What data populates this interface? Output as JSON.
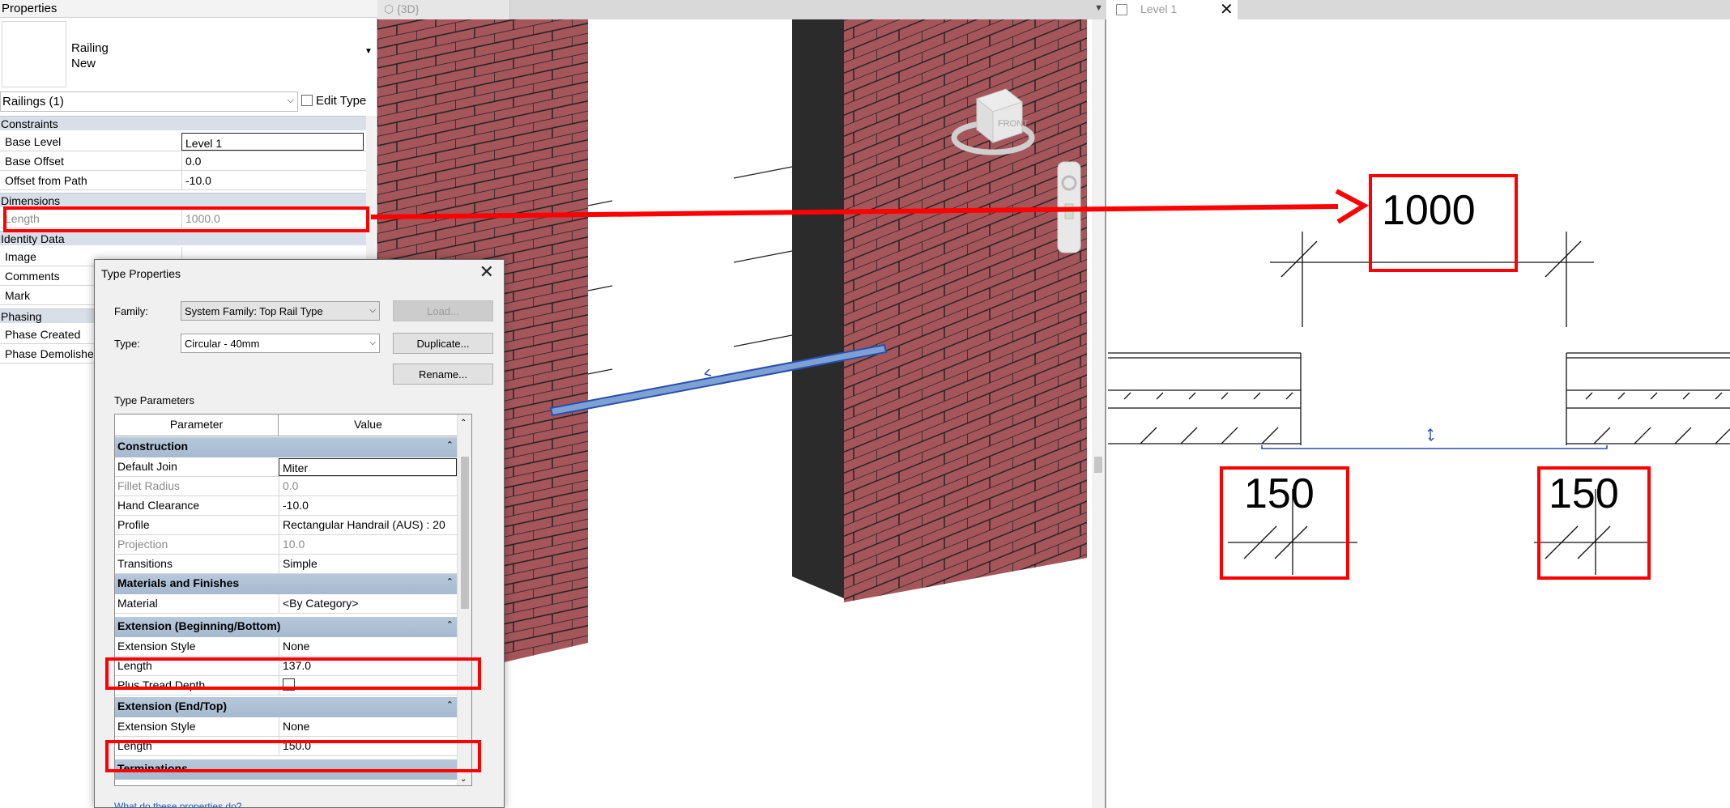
{
  "properties": {
    "title": "Properties",
    "type_name": "Railing",
    "type_sub": "New",
    "selector": "Railings (1)",
    "edit_type": "Edit Type",
    "sections": {
      "constraints": "Constraints",
      "dimensions": "Dimensions",
      "identity": "Identity Data",
      "phasing": "Phasing"
    },
    "rows": {
      "base_level": {
        "k": "Base Level",
        "v": "Level 1"
      },
      "base_offset": {
        "k": "Base Offset",
        "v": "0.0"
      },
      "offset_path": {
        "k": "Offset from Path",
        "v": "-10.0"
      },
      "length": {
        "k": "Length",
        "v": "1000.0"
      },
      "image": {
        "k": "Image"
      },
      "comments": {
        "k": "Comments"
      },
      "mark": {
        "k": "Mark"
      },
      "phase_created": {
        "k": "Phase Created"
      },
      "phase_demolished": {
        "k": "Phase Demolished"
      }
    }
  },
  "view3d": {
    "tab": "{3D}",
    "viewcube_face": "FRONT"
  },
  "plan": {
    "tab": "Level 1",
    "dim_top": "1000",
    "dim_left": "150",
    "dim_right": "150"
  },
  "dialog": {
    "title": "Type Properties",
    "family_label": "Family:",
    "family_value": "System Family: Top Rail Type",
    "type_label": "Type:",
    "type_value": "Circular - 40mm",
    "load": "Load...",
    "duplicate": "Duplicate...",
    "rename": "Rename...",
    "type_params": "Type Parameters",
    "col_param": "Parameter",
    "col_value": "Value",
    "col_eq": "=",
    "sections": {
      "construction": "Construction",
      "materials": "Materials and Finishes",
      "ext_begin": "Extension (Beginning/Bottom)",
      "ext_end": "Extension (End/Top)",
      "terminations": "Terminations"
    },
    "rows": {
      "default_join": {
        "k": "Default Join",
        "v": "Miter"
      },
      "fillet": {
        "k": "Fillet Radius",
        "v": "0.0"
      },
      "hand_clear": {
        "k": "Hand Clearance",
        "v": "-10.0"
      },
      "profile": {
        "k": "Profile",
        "v": "Rectangular Handrail (AUS) : 20"
      },
      "projection": {
        "k": "Projection",
        "v": "10.0"
      },
      "transitions": {
        "k": "Transitions",
        "v": "Simple"
      },
      "material": {
        "k": "Material",
        "v": "<By Category>"
      },
      "eb_style": {
        "k": "Extension Style",
        "v": "None"
      },
      "eb_length": {
        "k": "Length",
        "v": "137.0"
      },
      "eb_plus": {
        "k": "Plus Tread Depth"
      },
      "ee_style": {
        "k": "Extension Style",
        "v": "None"
      },
      "ee_length": {
        "k": "Length",
        "v": "150.0"
      }
    },
    "help_link": "What do these properties do?"
  },
  "colors": {
    "highlight": "#ff0000",
    "brick": "#a4565b",
    "section_bg": "#b7c8db"
  }
}
